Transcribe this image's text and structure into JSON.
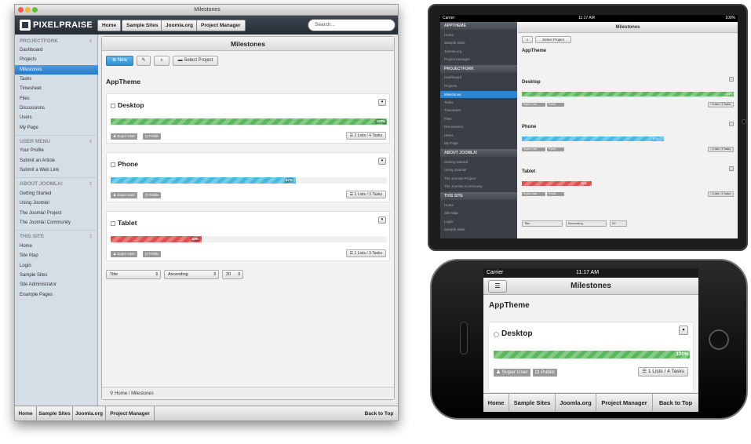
{
  "window": {
    "title": "Milestones"
  },
  "topbar": {
    "logo": "PIXELPRAISE",
    "buttons": [
      "Home",
      "Sample Sites",
      "Joomla.org",
      "Project Manager"
    ],
    "search_placeholder": "Search..."
  },
  "sidebar": {
    "sections": [
      {
        "title": "PROJECTFORK",
        "items": [
          "Dashboard",
          "Projects",
          "Milestones",
          "Tasks",
          "Timesheet",
          "Files",
          "Discussions",
          "Users",
          "My Page"
        ]
      },
      {
        "title": "USER MENU",
        "items": [
          "Your Profile",
          "Submit an Article",
          "Submit a Web Link"
        ]
      },
      {
        "title": "ABOUT JOOMLA!",
        "items": [
          "Getting Started",
          "Using Joomla!",
          "The Joomla! Project",
          "The Joomla! Community"
        ]
      },
      {
        "title": "THIS SITE",
        "items": [
          "Home",
          "Site Map",
          "Login",
          "Sample Sites",
          "Site Administrator",
          "Example Pages"
        ]
      }
    ],
    "active": "Milestones"
  },
  "main": {
    "header": "Milestones",
    "new_label": "New",
    "select_project_label": "Select Project",
    "project_title": "AppTheme",
    "milestones": [
      {
        "title": "Desktop",
        "progress": 100,
        "progress_label": "100%",
        "color": "#5cb85c",
        "author": "Super User",
        "access": "Public",
        "lists": "1 Lists / 4 Tasks"
      },
      {
        "title": "Phone",
        "progress": 67,
        "progress_label": "67%",
        "color": "#4bb8e4",
        "author": "Super User",
        "access": "Public",
        "lists": "1 Lists / 3 Tasks"
      },
      {
        "title": "Tablet",
        "progress": 33,
        "progress_label": "33%",
        "color": "#e05050",
        "author": "Super User",
        "access": "Public",
        "lists": "1 Lists / 3 Tasks"
      }
    ],
    "sort_field": "Title",
    "sort_order": "Ascending",
    "limit": "20",
    "breadcrumb": "Home / Milestones"
  },
  "footer": {
    "buttons": [
      "Home",
      "Sample Sites",
      "Joomla.org",
      "Project Manager"
    ],
    "back_to_top": "Back to Top"
  },
  "ipad": {
    "carrier": "Carrier",
    "time": "11:17 AM",
    "battery": "100%",
    "sections": [
      {
        "title": "APPTHEME",
        "items": [
          "Home",
          "Sample Sites",
          "Joomla.org",
          "Project Manager"
        ]
      },
      {
        "title": "PROJECTFORK",
        "items": [
          "Dashboard",
          "Projects",
          "Milestones",
          "Tasks",
          "Timesheet",
          "Files",
          "Discussions",
          "Users",
          "My Page"
        ]
      },
      {
        "title": "ABOUT JOOMLA!",
        "items": [
          "Getting Started",
          "Using Joomla!",
          "The Joomla! Project",
          "The Joomla! Community"
        ]
      },
      {
        "title": "THIS SITE",
        "items": [
          "Home",
          "Site Map",
          "Login",
          "Sample Sites"
        ]
      }
    ]
  },
  "iphone": {
    "carrier": "Carrier",
    "time": "11:17 AM",
    "footer": [
      "Home",
      "Sample Sites",
      "Joomla.org",
      "Project Manager",
      "Back to Top"
    ]
  }
}
